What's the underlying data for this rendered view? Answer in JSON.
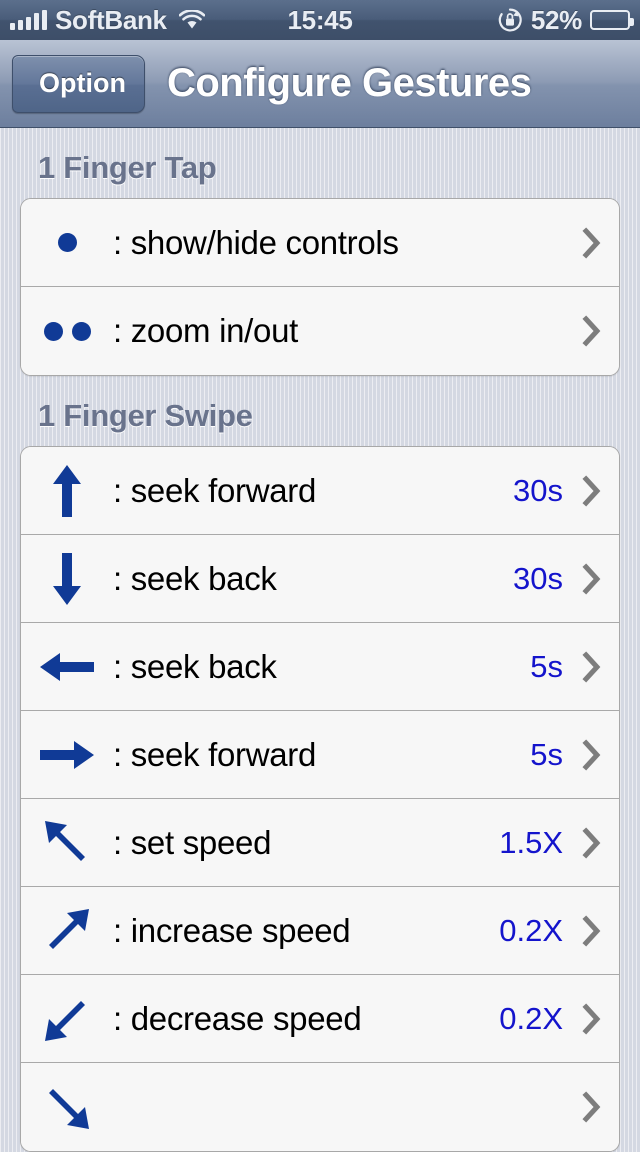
{
  "status_bar": {
    "carrier": "SoftBank",
    "time": "15:45",
    "battery_percent": "52%",
    "battery_level": 52,
    "signal_bars": 5,
    "icons": [
      "signal-bars-icon",
      "wifi-icon",
      "rotation-lock-icon",
      "battery-icon"
    ]
  },
  "nav_bar": {
    "back_label": "Option",
    "title": "Configure Gestures"
  },
  "sections": [
    {
      "header": "1 Finger Tap",
      "rows": [
        {
          "icon": "one-dot-icon",
          "dots": 1,
          "label": ": show/hide controls",
          "value": ""
        },
        {
          "icon": "two-dots-icon",
          "dots": 2,
          "label": ": zoom in/out",
          "value": ""
        }
      ]
    },
    {
      "header": "1 Finger Swipe",
      "rows": [
        {
          "icon": "arrow-up-icon",
          "label": ": seek forward",
          "value": "30s"
        },
        {
          "icon": "arrow-down-icon",
          "label": ": seek back",
          "value": "30s"
        },
        {
          "icon": "arrow-left-icon",
          "label": ": seek back",
          "value": "5s"
        },
        {
          "icon": "arrow-right-icon",
          "label": ": seek forward",
          "value": "5s"
        },
        {
          "icon": "arrow-up-left-icon",
          "label": ": set speed",
          "value": "1.5X"
        },
        {
          "icon": "arrow-up-right-icon",
          "label": ": increase speed",
          "value": "0.2X"
        },
        {
          "icon": "arrow-down-left-icon",
          "label": ": decrease speed",
          "value": "0.2X"
        }
      ]
    }
  ],
  "colors": {
    "value_blue": "#1414cc",
    "icon_blue": "#103a96",
    "chevron_gray": "#7d7d7d",
    "header_text": "#69738c",
    "background": "#d4d8e2"
  }
}
